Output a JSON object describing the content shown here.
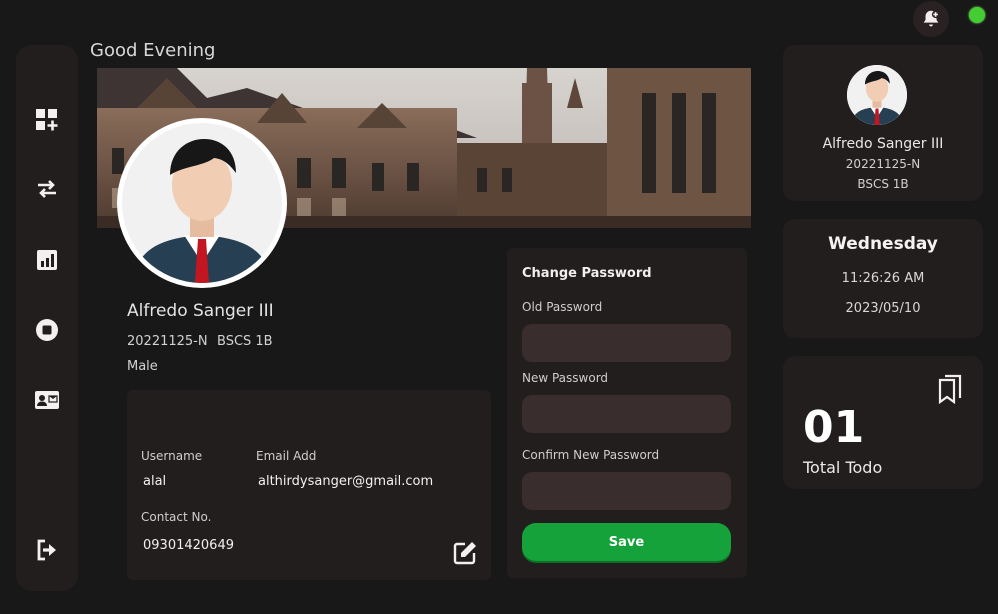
{
  "greeting": "Good Evening",
  "profile": {
    "name": "Alfredo Sanger III",
    "student_id": "20221125-N",
    "course": "BSCS 1B",
    "gender": "Male"
  },
  "account": {
    "username_label": "Username",
    "username": "alal",
    "email_label": "Email Add",
    "email": "althirdysanger@gmail.com",
    "contact_label": "Contact No.",
    "contact": "09301420649"
  },
  "password_form": {
    "title": "Change Password",
    "old_label": "Old Password",
    "new_label": "New Password",
    "confirm_label": "Confirm New Password",
    "save_label": "Save"
  },
  "user_card": {
    "name": "Alfredo Sanger III",
    "student_id": "20221125-N",
    "course": "BSCS 1B"
  },
  "datetime": {
    "day": "Wednesday",
    "time": "11:26:26 AM",
    "date": "2023/05/10"
  },
  "todo": {
    "count": "01",
    "label": "Total Todo"
  },
  "icons": {
    "sidebar": [
      "dashboard-add-icon",
      "transfer-icon",
      "chart-icon",
      "stop-icon",
      "contact-card-icon",
      "logout-icon"
    ],
    "header": [
      "notification-bell-icon"
    ],
    "edit": "edit-icon",
    "todo": "bookmark-icon"
  },
  "colors": {
    "accent_green": "#16a23a",
    "status_online": "#44cc33",
    "card_bg": "#231e1e",
    "input_bg": "#3a2d2d"
  }
}
